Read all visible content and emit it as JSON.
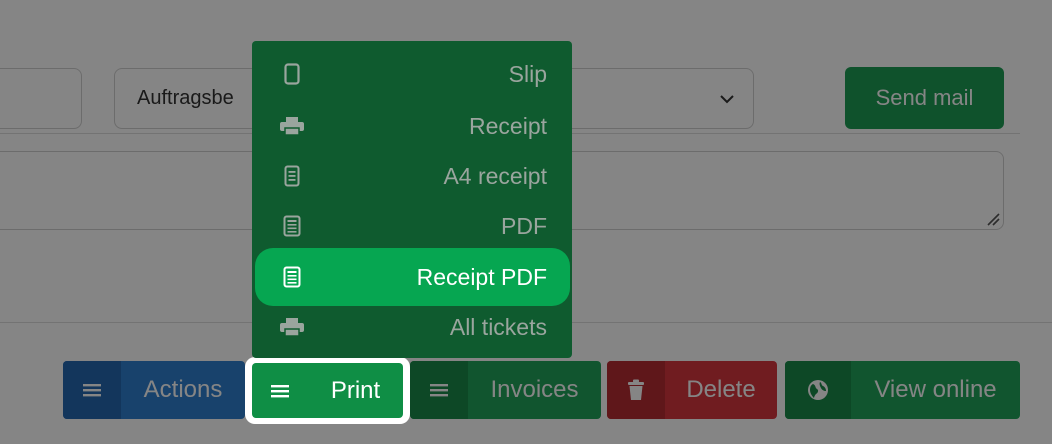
{
  "form": {
    "select_value": "Auftragsbe",
    "send_mail_label": "Send mail"
  },
  "toolbar": {
    "actions_label": "Actions",
    "print_label": "Print",
    "invoices_label": "Invoices",
    "delete_label": "Delete",
    "view_online_label": "View online"
  },
  "print_menu": {
    "items": [
      {
        "label": "Slip",
        "icon": "phone-icon"
      },
      {
        "label": "Receipt",
        "icon": "printer-icon"
      },
      {
        "label": "A4 receipt",
        "icon": "document-icon"
      },
      {
        "label": "PDF",
        "icon": "pdf-document-icon"
      },
      {
        "label": "Receipt PDF",
        "icon": "pdf-document-icon",
        "active": true
      },
      {
        "label": "All tickets",
        "icon": "printer-icon"
      }
    ]
  },
  "colors": {
    "accent_green": "#1e9e55",
    "menu_bg": "#0f5b2f",
    "menu_active": "#06a651",
    "actions_blue": "#2f7fd0",
    "delete_red": "#d7373f"
  }
}
